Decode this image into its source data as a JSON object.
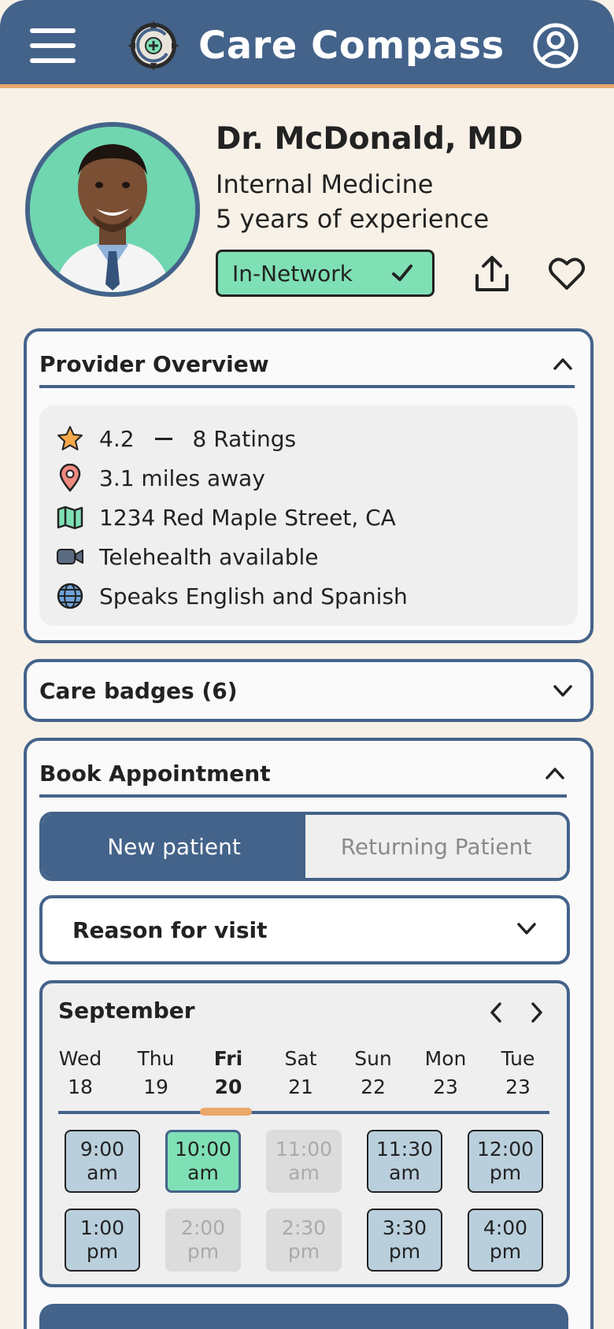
{
  "header": {
    "app_title": "Care Compass",
    "menu_icon": "hamburger-menu-icon",
    "logo_icon": "compass-logo-icon",
    "profile_icon": "user-circle-icon"
  },
  "doctor": {
    "name": "Dr. McDonald, MD",
    "specialty": "Internal Medicine",
    "experience": "5 years of experience",
    "network_label": "In-Network",
    "network_color": "#7fe0b5"
  },
  "overview": {
    "title": "Provider Overview",
    "rating": "4.2",
    "ratings_count": "8 Ratings",
    "distance": "3.1 miles away",
    "address": "1234 Red Maple Street, CA",
    "telehealth": "Telehealth available",
    "languages": "Speaks English and Spanish"
  },
  "badges": {
    "title": "Care badges (6)"
  },
  "booking": {
    "title": "Book Appointment",
    "tabs": [
      "New patient",
      "Returning Patient"
    ],
    "active_tab": "New patient",
    "reason_label": "Reason for visit",
    "month": "September",
    "days": [
      {
        "dow": "Wed",
        "date": "18"
      },
      {
        "dow": "Thu",
        "date": "19"
      },
      {
        "dow": "Fri",
        "date": "20"
      },
      {
        "dow": "Sat",
        "date": "21"
      },
      {
        "dow": "Sun",
        "date": "22"
      },
      {
        "dow": "Mon",
        "date": "23"
      },
      {
        "dow": "Tue",
        "date": "23"
      }
    ],
    "selected_day": "Fri 20",
    "slots": [
      {
        "time": "9:00\nam",
        "status": "available"
      },
      {
        "time": "10:00\nam",
        "status": "selected"
      },
      {
        "time": "11:00\nam",
        "status": "unavailable"
      },
      {
        "time": "11:30\nam",
        "status": "available"
      },
      {
        "time": "12:00\npm",
        "status": "available"
      },
      {
        "time": "1:00\npm",
        "status": "available"
      },
      {
        "time": "2:00\npm",
        "status": "unavailable"
      },
      {
        "time": "2:30\npm",
        "status": "unavailable"
      },
      {
        "time": "3:30\npm",
        "status": "available"
      },
      {
        "time": "4:00\npm",
        "status": "available"
      }
    ]
  },
  "colors": {
    "primary": "#44638a",
    "accent": "#eca76a",
    "background": "#f7f1e7",
    "selected": "#7fe0b5",
    "slot": "#b9cfdc"
  }
}
